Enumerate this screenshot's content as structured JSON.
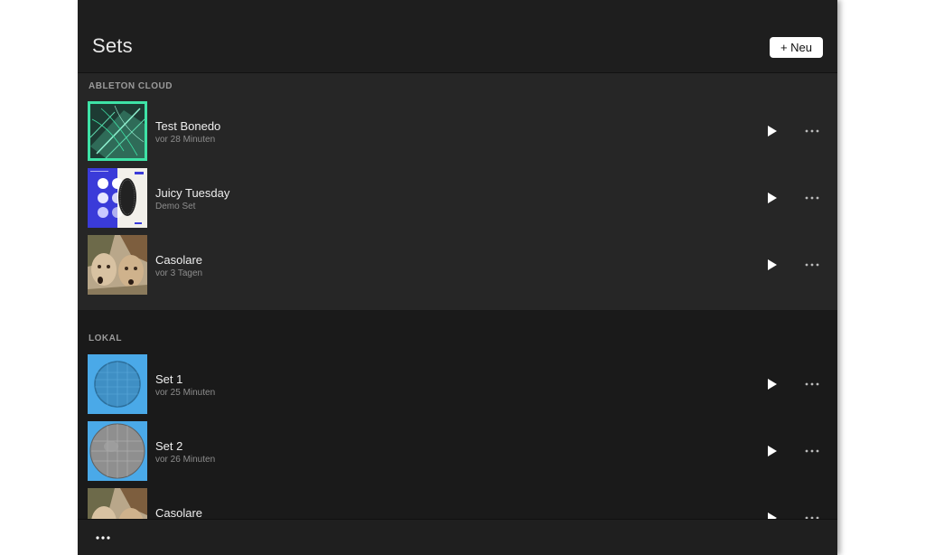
{
  "header": {
    "title": "Sets",
    "new_button_label": "+ Neu"
  },
  "sections": {
    "cloud": {
      "label": "ABLETON CLOUD",
      "items": [
        {
          "title": "Test Bonedo",
          "subtitle": "vor 28 Minuten",
          "thumb": "green-leaf-texture"
        },
        {
          "title": "Juicy Tuesday",
          "subtitle": "Demo Set",
          "thumb": "blue-poster-art"
        },
        {
          "title": "Casolare",
          "subtitle": "vor 3 Tagen",
          "thumb": "painted-faces-artwork"
        }
      ]
    },
    "local": {
      "label": "LOKAL",
      "items": [
        {
          "title": "Set 1",
          "subtitle": "vor 25 Minuten",
          "thumb": "blue-circle-texture"
        },
        {
          "title": "Set 2",
          "subtitle": "vor 26 Minuten",
          "thumb": "grey-circle-texture"
        },
        {
          "title": "Casolare",
          "subtitle": "",
          "thumb": "painted-faces-artwork"
        }
      ]
    }
  },
  "icons": {
    "play": "play-icon",
    "more": "more-icon"
  },
  "colors": {
    "background": "#1a1a1a",
    "cloud_section": "#262626",
    "accent_green": "#3ee2a6",
    "accent_blue": "#4aa9e8",
    "text_primary": "#eeeeee",
    "text_secondary": "#8d8d8d"
  }
}
